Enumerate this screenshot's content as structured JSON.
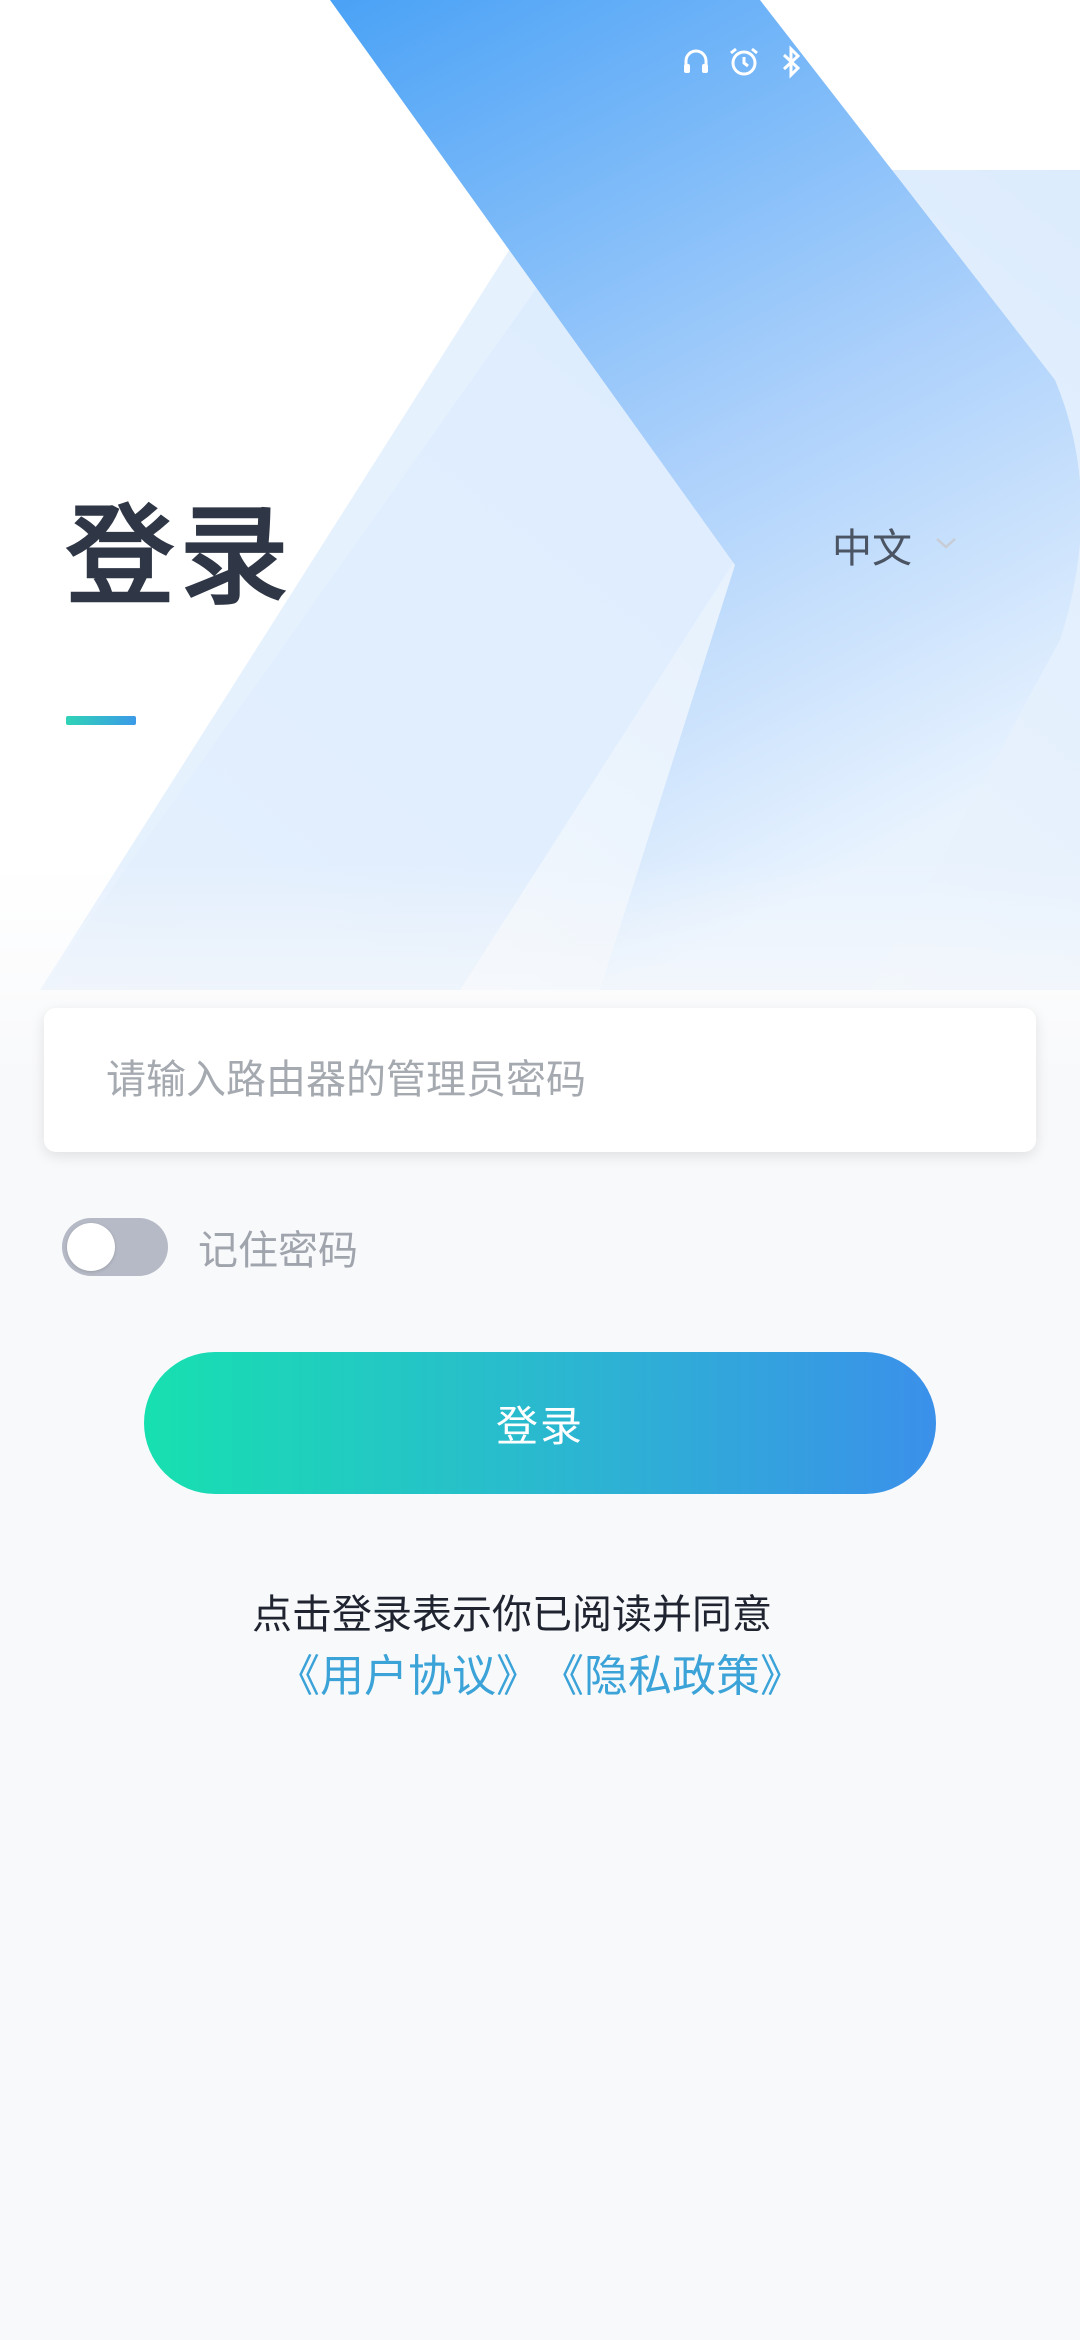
{
  "login": {
    "title": "登录",
    "language": "中文",
    "password_placeholder": "请输入路由器的管理员密码",
    "remember_label": "记住密码",
    "remember_enabled": false,
    "login_button": "登录",
    "agreement_text": "点击登录表示你已阅读并同意",
    "user_agreement_link": "《用户协议》",
    "privacy_policy_link": "《隐私政策》"
  },
  "colors": {
    "accent_gradient_start": "#17e0b0",
    "accent_gradient_end": "#3b90ea",
    "link": "#3ba3d8",
    "hero_blue": "#4fa3f5"
  },
  "icons": {
    "status_bar": [
      "headset-icon",
      "alarm-icon",
      "bluetooth-icon"
    ],
    "language_dropdown": "chevron-down-icon"
  }
}
